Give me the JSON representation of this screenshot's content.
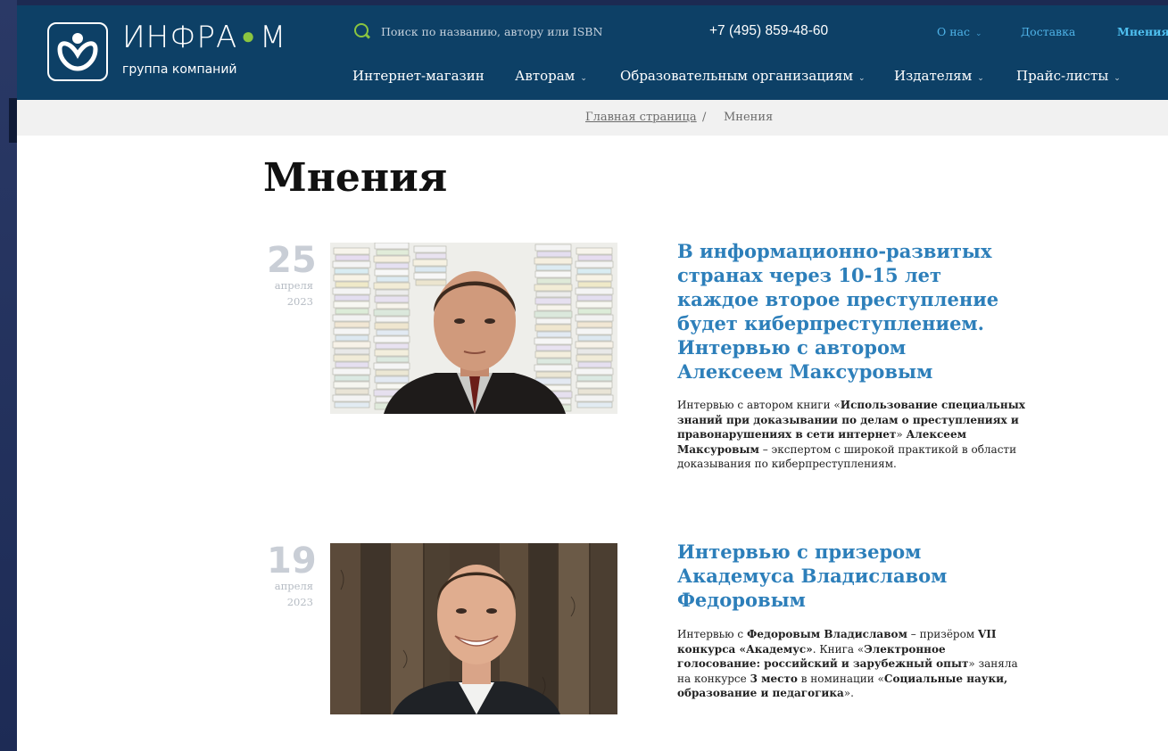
{
  "logo": {
    "name_left": "ИНФРА",
    "name_right": "М",
    "subtitle": "группа компаний"
  },
  "search": {
    "placeholder": "Поиск по названию, автору или ISBN"
  },
  "phone": "+7 (495) 859-48-60",
  "top_links": [
    {
      "label": "О нас",
      "has_dropdown": true
    },
    {
      "label": "Доставка",
      "has_dropdown": false
    },
    {
      "label": "Мнения",
      "has_dropdown": false,
      "active": true
    }
  ],
  "main_nav": [
    {
      "label": "Интернет-магазин",
      "has_dropdown": false
    },
    {
      "label": "Авторам",
      "has_dropdown": true
    },
    {
      "label": "Образовательным организациям",
      "has_dropdown": true
    },
    {
      "label": "Издателям",
      "has_dropdown": true
    },
    {
      "label": "Прайс-листы",
      "has_dropdown": true
    }
  ],
  "breadcrumbs": {
    "home": "Главная страница",
    "separator": "/",
    "current": "Мнения"
  },
  "page_title": "Мнения",
  "articles": [
    {
      "day": "25",
      "month": "апреля",
      "year": "2023",
      "title": "В информационно-развитых странах через 10-15 лет каждое второе преступление будет киберпреступлением. Интервью с автором Алексеем Максуровым",
      "desc": [
        {
          "text": "Интервью с автором книги «",
          "bold": false
        },
        {
          "text": "Использование специальных знаний при доказывании по делам о преступлениях и правонарушениях в сети интернет",
          "bold": true
        },
        {
          "text": "» ",
          "bold": false
        },
        {
          "text": "Алексеем Максуровым",
          "bold": true
        },
        {
          "text": " – экспертом с широкой практикой в области доказывания по киберпреступлениям.",
          "bold": false
        }
      ]
    },
    {
      "day": "19",
      "month": "апреля",
      "year": "2023",
      "title": "Интервью с призером Академуса Владиславом Федоровым",
      "desc": [
        {
          "text": "Интервью с ",
          "bold": false
        },
        {
          "text": "Федоровым Владиславом",
          "bold": true
        },
        {
          "text": " – призёром ",
          "bold": false
        },
        {
          "text": "VII конкурса «Академус»",
          "bold": true
        },
        {
          "text": ". Книга «",
          "bold": false
        },
        {
          "text": "Электронное голосование: российский и зарубежный опыт",
          "bold": true
        },
        {
          "text": "» заняла на конкурсе ",
          "bold": false
        },
        {
          "text": "3 место",
          "bold": true
        },
        {
          "text": " в номинации «",
          "bold": false
        },
        {
          "text": "Социальные науки, образование и педагогика",
          "bold": true
        },
        {
          "text": "».",
          "bold": false
        }
      ]
    }
  ],
  "colors": {
    "header_bg": "#0d4066",
    "accent_green": "#8bc540",
    "link_blue": "#2d7fba",
    "date_gray": "#c9ced6"
  }
}
